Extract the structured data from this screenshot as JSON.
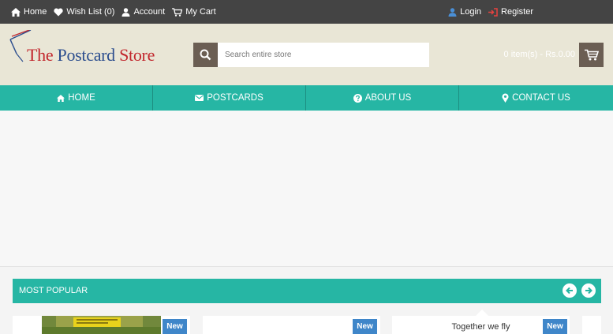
{
  "topbar": {
    "home": "Home",
    "wishlist": "Wish List (0)",
    "account": "Account",
    "mycart": "My Cart",
    "login": "Login",
    "register": "Register"
  },
  "header": {
    "logo_part1": "The ",
    "logo_part2": "Postcard",
    "logo_part3": " Store",
    "search_placeholder": "Search entire store",
    "cart_summary": "0 item(s) - Rs.0.00"
  },
  "nav": {
    "home": "HOME",
    "postcards": "POSTCARDS",
    "about": "ABOUT US",
    "contact": "CONTACT US"
  },
  "popular": {
    "title": "MOST POPULAR"
  },
  "products": [
    {
      "badge": "New",
      "title": ""
    },
    {
      "badge": "New",
      "title": ""
    },
    {
      "badge": "New",
      "title": "Together we fly"
    }
  ],
  "colors": {
    "topbar": "#444444",
    "header_bg": "#e9e6d6",
    "accent_teal": "#26b6a4",
    "button_brown": "#6b5e53",
    "badge_blue": "#3f86c9"
  }
}
